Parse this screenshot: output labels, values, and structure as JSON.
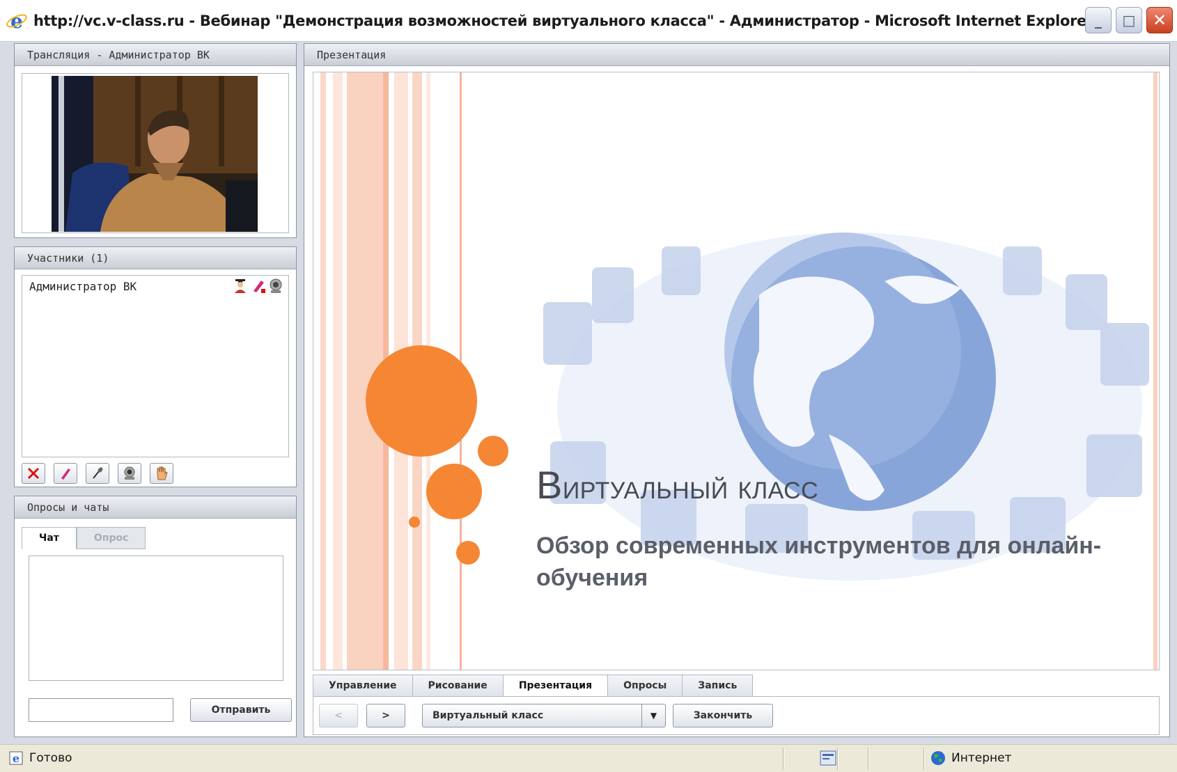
{
  "window": {
    "title": "http://vc.v-class.ru - Вебинар \"Демонстрация возможностей виртуального класса\" - Администратор  - Microsoft Internet Explorer"
  },
  "broadcast": {
    "header": "Трансляция - Администратор ВК"
  },
  "participants": {
    "header": "Участники (1)",
    "items": [
      {
        "name": "Администратор ВК"
      }
    ],
    "tools": [
      "remove-icon",
      "draw-permission-icon",
      "microphone-icon",
      "webcam-icon",
      "raise-hand-icon"
    ]
  },
  "chats": {
    "header": "Опросы и чаты",
    "tabs": [
      {
        "label": "Чат",
        "active": true
      },
      {
        "label": "Опрос",
        "active": false
      }
    ],
    "input_value": "",
    "send_label": "Отправить"
  },
  "presentation": {
    "header": "Презентация",
    "slide": {
      "title_first_letter": "В",
      "title_rest": "иртуальный класс",
      "subtitle": "Обзор современных инструментов для онлайн-обучения"
    },
    "tabs": [
      {
        "label": "Управление",
        "active": false
      },
      {
        "label": "Рисование",
        "active": false
      },
      {
        "label": "Презентация",
        "active": true
      },
      {
        "label": "Опросы",
        "active": false
      },
      {
        "label": "Запись",
        "active": false
      }
    ],
    "controls": {
      "prev_label": "<",
      "next_label": ">",
      "selected_presentation": "Виртуальный класс",
      "finish_label": "Закончить"
    }
  },
  "statusbar": {
    "status": "Готово",
    "zone": "Интернет"
  },
  "colors": {
    "accent_orange": "#f58634",
    "stripe_pink": "#f9c9b6",
    "globe_blue": "#7e9fd6"
  }
}
